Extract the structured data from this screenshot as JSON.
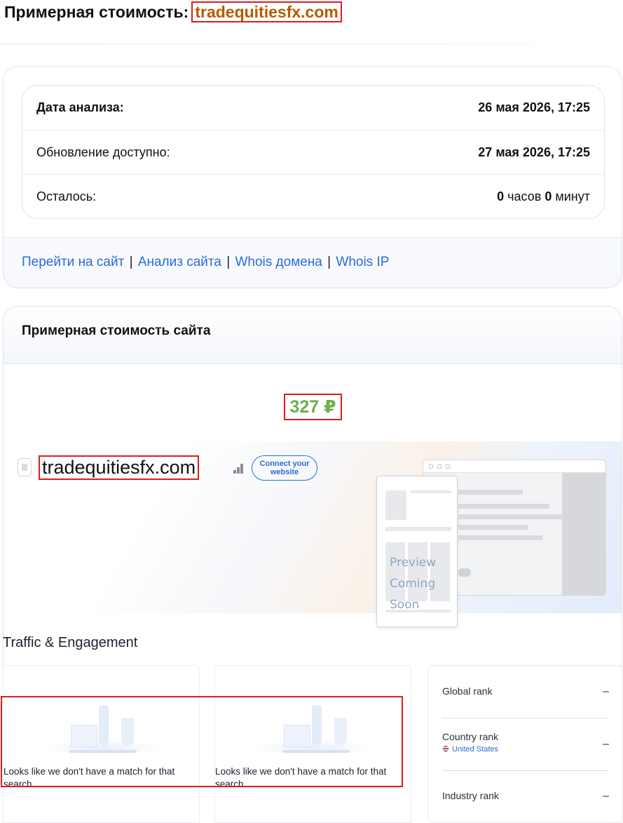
{
  "header": {
    "title_prefix": "Примерная стоимость:",
    "domain": "tradequitiesfx.com"
  },
  "analysis": {
    "rows": [
      {
        "label": "Дата анализа:",
        "value": "26 мая 2026, 17:25"
      },
      {
        "label": "Обновление доступно:",
        "value": "27 мая 2026, 17:25"
      },
      {
        "label": "Осталось:",
        "hours": "0",
        "hours_unit": "часов",
        "minutes": "0",
        "minutes_unit": "минут"
      }
    ],
    "links": [
      "Перейти на сайт",
      "Анализ сайта",
      "Whois домена",
      "Whois IP"
    ],
    "link_separator": "|"
  },
  "valuation": {
    "title": "Примерная стоимость сайта",
    "price": "327 ₽",
    "price_color": "#6ab04c"
  },
  "preview": {
    "domain": "tradequitiesfx.com",
    "connect_button": "Connect your website",
    "coming_soon": [
      "Preview",
      "Coming Soon"
    ]
  },
  "traffic": {
    "title": "Traffic & Engagement",
    "empty_message": "Looks like we don't have a match for that search.",
    "ranks": [
      {
        "label": "Global rank",
        "value": "–"
      },
      {
        "label": "Country rank",
        "sub": "United States",
        "value": "–"
      },
      {
        "label": "Industry rank",
        "value": "–"
      }
    ]
  },
  "colors": {
    "link": "#2a6bd8",
    "highlight_border": "#e01c1c",
    "title_domain": "#b35c00"
  }
}
